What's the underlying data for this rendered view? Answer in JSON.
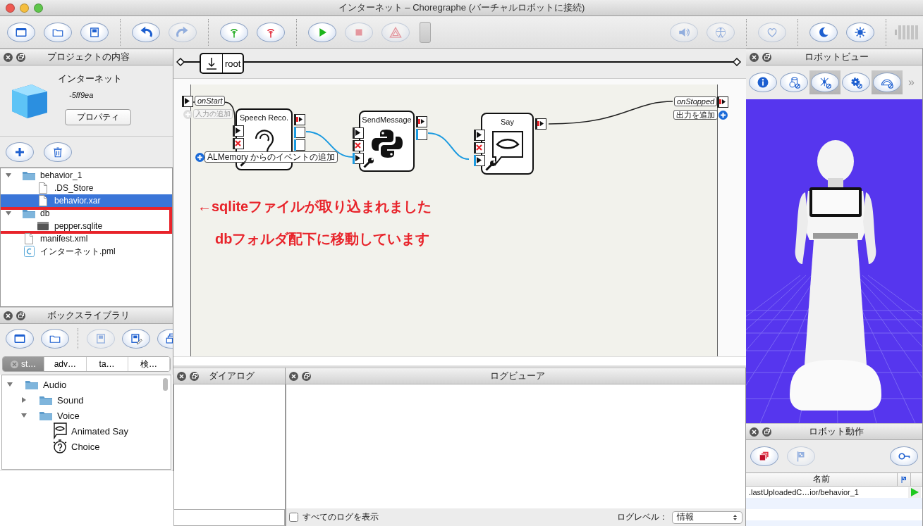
{
  "window": {
    "title": "インターネット – Choregraphe (バーチャルロボットに接続)"
  },
  "toolbar": {
    "left": [
      [
        {
          "kind": "new",
          "disabled": false
        },
        {
          "kind": "open",
          "disabled": false
        },
        {
          "kind": "save",
          "disabled": false
        }
      ],
      [
        {
          "kind": "undo",
          "disabled": false
        },
        {
          "kind": "redo",
          "disabled": true
        }
      ],
      [
        {
          "kind": "connect",
          "disabled": false
        },
        {
          "kind": "disconnect",
          "disabled": false
        }
      ],
      [
        {
          "kind": "play",
          "disabled": false
        },
        {
          "kind": "stop",
          "disabled": true
        },
        {
          "kind": "warning",
          "disabled": true
        }
      ]
    ],
    "right": [
      [
        {
          "kind": "volume",
          "disabled": true
        },
        {
          "kind": "body",
          "disabled": true
        }
      ],
      [
        {
          "kind": "heart",
          "disabled": true
        }
      ],
      [
        {
          "kind": "rest",
          "disabled": false
        },
        {
          "kind": "awake",
          "disabled": false
        }
      ]
    ]
  },
  "project": {
    "title": "プロジェクトの内容",
    "name": "インターネット",
    "version": "-5ff9ea",
    "properties_button": "プロパティ",
    "tools": [
      {
        "kind": "add",
        "disabled": false
      },
      {
        "kind": "trash",
        "disabled": false
      }
    ],
    "tree": [
      {
        "label": "behavior_1",
        "kind": "folder",
        "expanded": true,
        "selected": false,
        "annotated": false,
        "children": [
          {
            "label": ".DS_Store",
            "kind": "file",
            "selected": false,
            "annotated": false
          },
          {
            "label": "behavior.xar",
            "kind": "file",
            "selected": true,
            "annotated": false
          }
        ]
      },
      {
        "label": "db",
        "kind": "folder",
        "expanded": true,
        "selected": false,
        "annotated": true,
        "children": [
          {
            "label": "pepper.sqlite",
            "kind": "database",
            "selected": false,
            "annotated": false
          }
        ]
      },
      {
        "label": "manifest.xml",
        "kind": "file",
        "selected": false,
        "annotated": false
      },
      {
        "label": "インターネット.pml",
        "kind": "project",
        "selected": false,
        "annotated": false
      }
    ]
  },
  "diagram": {
    "breadcrumb": "root",
    "start_input": "onStart",
    "add_input": "入力の追加",
    "add_event": "ALMemory からのイベントの追加",
    "stop_output": "onStopped",
    "add_output": "出力を追加",
    "boxes": [
      {
        "title": "Speech Reco.",
        "kind": "ear"
      },
      {
        "title": "SendMessage",
        "kind": "python"
      },
      {
        "title": "Say",
        "kind": "speech"
      }
    ],
    "annotation": [
      "←sqliteファイルが取り込まれました",
      "dbフォルダ配下に移動しています"
    ]
  },
  "box_library": {
    "title": "ボックスライブラリ",
    "tools": [
      {
        "kind": "new",
        "disabled": false
      },
      {
        "kind": "open",
        "disabled": false
      },
      {
        "kind": "save",
        "disabled": true
      },
      {
        "kind": "saveas",
        "disabled": false
      },
      {
        "kind": "windows",
        "disabled": false
      }
    ],
    "tabs": [
      {
        "label": "st…",
        "selected": true
      },
      {
        "label": "adv…",
        "selected": false
      },
      {
        "label": "ta…",
        "selected": false
      },
      {
        "label": "検…",
        "selected": false
      }
    ],
    "tree": [
      {
        "label": "Audio",
        "kind": "folder",
        "expanded": true,
        "selected": false,
        "children": [
          {
            "label": "Sound",
            "kind": "folder",
            "expanded": false,
            "selected": false
          },
          {
            "label": "Voice",
            "kind": "folder",
            "expanded": true,
            "selected": false,
            "children": [
              {
                "label": "Animated Say",
                "kind": "say",
                "selected": false
              },
              {
                "label": "Choice",
                "kind": "choice",
                "selected": false
              }
            ]
          }
        ]
      }
    ]
  },
  "dialog": {
    "title": "ダイアログ"
  },
  "log_viewer": {
    "title": "ログビューア",
    "show_all": {
      "label": "すべてのログを表示",
      "checked": false
    },
    "level_label": "ログレベル：",
    "level_value": "情報"
  },
  "robot_view": {
    "title": "ロボットビュー",
    "tools": [
      {
        "kind": "info",
        "pressed": false
      },
      {
        "kind": "cylinder",
        "pressed": false
      },
      {
        "kind": "joint",
        "pressed": true
      },
      {
        "kind": "gear",
        "pressed": false
      },
      {
        "kind": "gauge",
        "pressed": true
      }
    ],
    "more": "»"
  },
  "robot_actions": {
    "title": "ロボット動作",
    "tools": [
      {
        "kind": "stack",
        "disabled": false
      },
      {
        "kind": "flag",
        "disabled": true
      },
      {
        "kind": "search",
        "disabled": false
      }
    ],
    "column": "名前",
    "rows": [
      {
        "name": ".lastUploadedC…ior/behavior_1"
      }
    ]
  }
}
